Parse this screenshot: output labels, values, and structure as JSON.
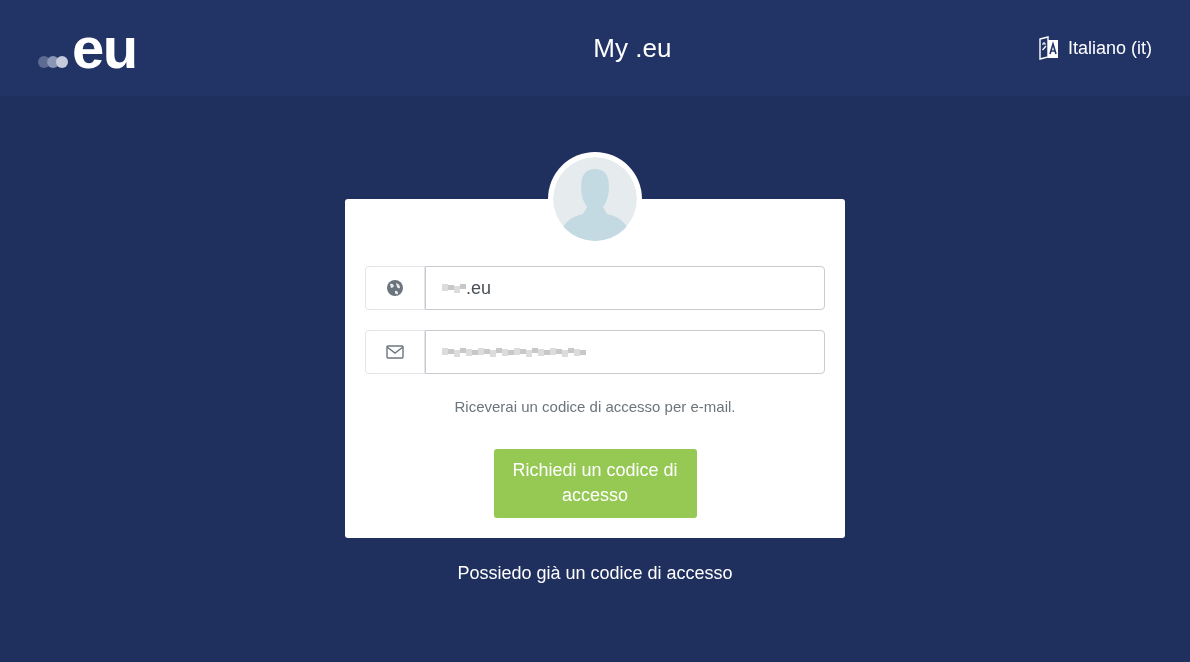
{
  "header": {
    "logo_text": "eu",
    "title": "My .eu",
    "language": "Italiano (it)"
  },
  "form": {
    "domain_field": {
      "value": ".eu",
      "redacted": true
    },
    "email_field": {
      "redacted": true
    },
    "hint": "Riceverai un codice di accesso per e-mail.",
    "submit_button": "Richiedi un codice di accesso"
  },
  "footer_link": "Possiedo già un codice di accesso"
}
